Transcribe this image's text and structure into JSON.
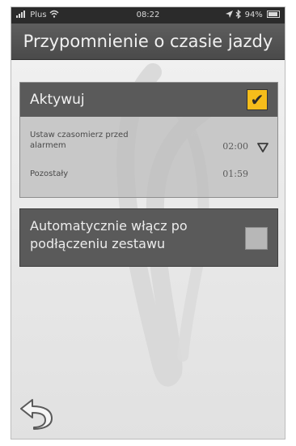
{
  "status_bar": {
    "carrier": "Plus",
    "time": "08:22",
    "battery": "94%"
  },
  "header": {
    "title": "Przypomnienie o czasie jazdy"
  },
  "section_activate": {
    "label": "Aktywuj",
    "checked": true,
    "check_glyph": "✔",
    "rows": [
      {
        "label": "Ustaw czasomierz przed alarmem",
        "value": "02:00"
      },
      {
        "label": "Pozostały",
        "value": "01:59"
      }
    ]
  },
  "section_auto": {
    "label": "Automatycznie włącz po podłączeniu zestawu",
    "checked": false
  },
  "colors": {
    "accent": "#f6bd1b",
    "header_bg": "#4f4f4f",
    "section_dark": "#5a5a5a"
  },
  "icons": {
    "back": "back-arrow-icon",
    "dropdown": "triangle-down-icon",
    "signal": "signal-icon",
    "wifi": "wifi-icon",
    "location": "location-arrow-icon",
    "bluetooth": "bluetooth-icon",
    "battery": "battery-icon"
  }
}
